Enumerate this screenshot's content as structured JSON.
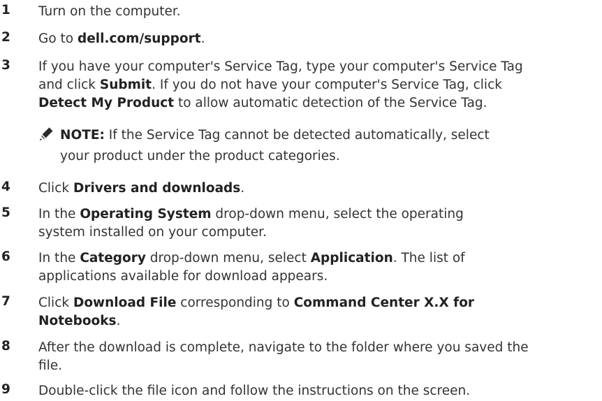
{
  "steps": [
    {
      "num": "1",
      "parts": [
        "Turn on the computer."
      ]
    },
    {
      "num": "2",
      "parts": [
        "Go to ",
        "dell.com/support",
        "."
      ]
    },
    {
      "num": "3",
      "line1": [
        "If you have your computer's Service Tag, type your computer's Service Tag"
      ],
      "line2": [
        "and click ",
        "Submit",
        ". If you do not have your computer's Service Tag, click"
      ],
      "line3": [
        "Detect My Product",
        " to allow automatic detection of the Service Tag."
      ]
    },
    {
      "num": "4",
      "parts": [
        "Click ",
        "Drivers and downloads",
        "."
      ]
    },
    {
      "num": "5",
      "line1": [
        "In the ",
        "Operating System",
        " drop-down menu, select the operating"
      ],
      "line2": [
        "system installed on your computer."
      ]
    },
    {
      "num": "6",
      "line1": [
        "In the ",
        "Category",
        " drop-down menu, select ",
        "Application",
        ". The list of"
      ],
      "line2": [
        "applications available for download appears."
      ]
    },
    {
      "num": "7",
      "line1": [
        "Click ",
        "Download File",
        " corresponding to ",
        "Command Center X.X for"
      ],
      "line2": [
        "Notebooks",
        "."
      ]
    },
    {
      "num": "8",
      "line1": [
        "After the download is complete, navigate to the folder where you saved the"
      ],
      "line2": [
        "file."
      ]
    },
    {
      "num": "9",
      "parts": [
        "Double-click the file icon and follow the instructions on the screen."
      ]
    }
  ],
  "note": {
    "label": "NOTE:",
    "line1": " If the Service Tag cannot be detected automatically, select",
    "line2": "your product under the product categories.",
    "icon": "pencil-note-icon"
  }
}
